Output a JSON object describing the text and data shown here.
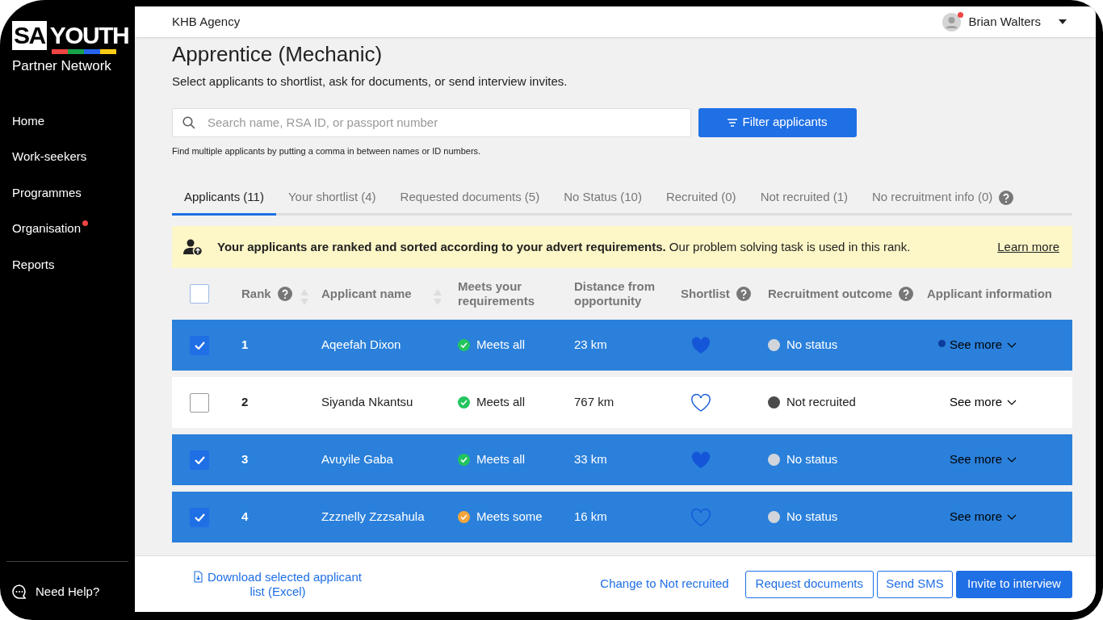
{
  "sidebar": {
    "logo": {
      "top_left": "SA",
      "top_right": "YOUTH",
      "subtitle": "Partner Network"
    },
    "items": [
      {
        "label": "Home",
        "notification": false
      },
      {
        "label": "Work-seekers",
        "notification": false
      },
      {
        "label": "Programmes",
        "notification": false
      },
      {
        "label": "Organisation",
        "notification": true
      },
      {
        "label": "Reports",
        "notification": false
      }
    ],
    "help": "Need Help?"
  },
  "header": {
    "organisation": "KHB Agency",
    "user": "Brian Walters",
    "user_notification": true
  },
  "page": {
    "title": "Apprentice (Mechanic)",
    "subtitle": "Select applicants to shortlist, ask for documents, or send interview invites."
  },
  "search": {
    "placeholder": "Search name, RSA ID, or passport number",
    "hint": "Find multiple applicants by putting a comma in between names or ID numbers.",
    "filter_button": "Filter applicants"
  },
  "tabs": [
    {
      "label": "Applicants (11)",
      "selected": true,
      "help": false
    },
    {
      "label": "Your shortlist (4)",
      "selected": false,
      "help": false
    },
    {
      "label": "Requested documents (5)",
      "selected": false,
      "help": false
    },
    {
      "label": "No Status (10)",
      "selected": false,
      "help": false
    },
    {
      "label": "Recruited (0)",
      "selected": false,
      "help": false
    },
    {
      "label": "Not recruited (1)",
      "selected": false,
      "help": false
    },
    {
      "label": "No recruitment info (0)",
      "selected": false,
      "help": true
    }
  ],
  "banner": {
    "text": "**Your applicants are ranked and sorted according to your advert requirements.** Our problem solving task is used in this rank.",
    "link": "Learn more"
  },
  "table": {
    "all_checked": false,
    "columns": [
      {
        "label": "Rank",
        "help": true,
        "sortable": true
      },
      {
        "label": "Applicant name",
        "help": false,
        "sortable": true
      },
      {
        "label": "Meets your requirements",
        "help": false,
        "sortable": false
      },
      {
        "label": "Distance from opportunity",
        "help": false,
        "sortable": false
      },
      {
        "label": "Shortlist",
        "help": true,
        "sortable": false
      },
      {
        "label": "Recruitment outcome",
        "help": true,
        "sortable": false
      },
      {
        "label": "Applicant information",
        "help": false,
        "sortable": false
      }
    ],
    "rows": [
      {
        "selected": true,
        "rank": "1",
        "name": "Aqeefah Dixon",
        "requirements": "Meets all",
        "meets_all": true,
        "distance": "23 km",
        "shortlisted": true,
        "outcome": "No status",
        "color": "#d1d5db",
        "info": "See more",
        "unread": true
      },
      {
        "selected": false,
        "rank": "2",
        "name": "Siyanda Nkantsu",
        "requirements": "Meets all",
        "meets_all": true,
        "distance": "767 km",
        "shortlisted": false,
        "outcome": "Not recruited",
        "color": "#4b4b4b",
        "info": "See more",
        "unread": false
      },
      {
        "selected": true,
        "rank": "3",
        "name": "Avuyile Gaba",
        "requirements": "Meets all",
        "meets_all": true,
        "distance": "33 km",
        "shortlisted": true,
        "outcome": "No status",
        "color": "#d1d5db",
        "info": "See more",
        "unread": false
      },
      {
        "selected": true,
        "rank": "4",
        "name": "Zzznelly Zzzsahula",
        "requirements": "Meets some",
        "meets_all": false,
        "distance": "16 km",
        "shortlisted": false,
        "outcome": "No status",
        "color": "#d1d5db",
        "info": "See more",
        "unread": false
      }
    ]
  },
  "actions": {
    "download": "Download selected applicant list (Excel)",
    "not_recruited": "Change to Not recruited",
    "request_documents": "Request documents",
    "send_sms": "Send SMS",
    "invite": "Invite to interview"
  }
}
